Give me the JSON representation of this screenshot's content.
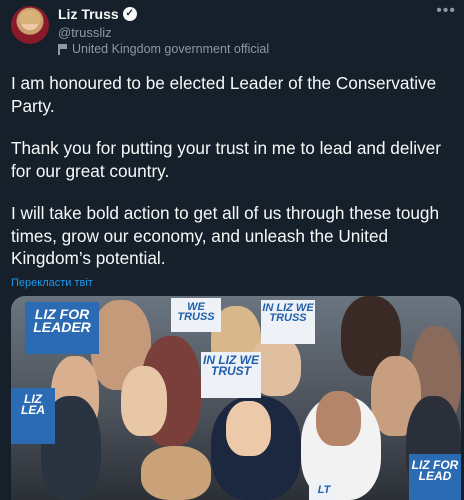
{
  "header": {
    "display_name": "Liz Truss",
    "handle": "@trussliz",
    "affiliation": "United Kingdom government official"
  },
  "tweet": {
    "paragraphs": [
      "I am honoured to be elected Leader of the Conservative Party.",
      "Thank you for putting your trust in me to lead and deliver for our great country.",
      "I will take bold action to get all of us through these tough times, grow our economy, and unleash the United Kingdom’s potential."
    ],
    "translate_label": "Перекласти твіт"
  },
  "photo": {
    "signs": [
      "LIZ FOR LEADER",
      "WE TRUSS",
      "IN LIZ WE TRUSS",
      "IN LIZ WE TRUST",
      "LIZ LEA",
      "LIZ FOR LEAD",
      "LT"
    ]
  },
  "icons": {
    "verified": "verified-badge-icon",
    "flag": "flag-icon",
    "more": "more-icon"
  },
  "colors": {
    "background": "#15202b",
    "text": "#f7f9f9",
    "secondary": "#8b98a5",
    "link": "#1d9bf0",
    "sign_blue": "#2a6bb3"
  }
}
